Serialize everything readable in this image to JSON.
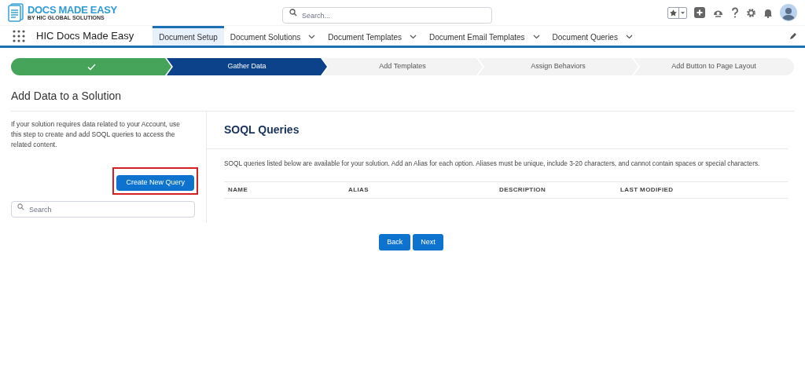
{
  "header": {
    "logo": {
      "title": "DOCS MADE EASY",
      "subtitle": "BY HIC GLOBAL SOLUTIONS"
    },
    "search": {
      "placeholder": "Search..."
    }
  },
  "nav": {
    "app_name": "HIC Docs Made Easy",
    "tabs": [
      {
        "label": "Document Setup",
        "selected": true,
        "dropdown": false
      },
      {
        "label": "Document Solutions",
        "selected": false,
        "dropdown": true
      },
      {
        "label": "Document Templates",
        "selected": false,
        "dropdown": true
      },
      {
        "label": "Document Email Templates",
        "selected": false,
        "dropdown": true
      },
      {
        "label": "Document Queries",
        "selected": false,
        "dropdown": true
      }
    ]
  },
  "path": {
    "steps": [
      {
        "completed": true,
        "selected": false
      },
      {
        "label": "Gather Data",
        "completed": false,
        "selected": true
      },
      {
        "label": "Add Templates",
        "completed": false,
        "selected": false
      },
      {
        "label": "Assign Behaviors",
        "completed": false,
        "selected": false
      },
      {
        "label": "Add Button to Page Layout",
        "completed": false,
        "selected": false
      }
    ]
  },
  "page_title": "Add Data to a Solution",
  "left_panel": {
    "description": "If your solution requires data related to your Account, use this step to create and add SOQL queries to access the related content.",
    "button": "Create New Query",
    "highlighted": true,
    "search": {
      "placeholder": "Search"
    }
  },
  "main_panel": {
    "title": "SOQL Queries",
    "description": "SOQL queries listed below are available for your solution. Add an Alias for each option. Aliases must be unique, include 3-20 characters, and cannot contain spaces or special characters.",
    "table": {
      "columns": [
        "NAME",
        "ALIAS",
        "DESCRIPTION",
        "LAST MODIFIED"
      ]
    }
  },
  "buttons": [
    "Back",
    "Next"
  ]
}
